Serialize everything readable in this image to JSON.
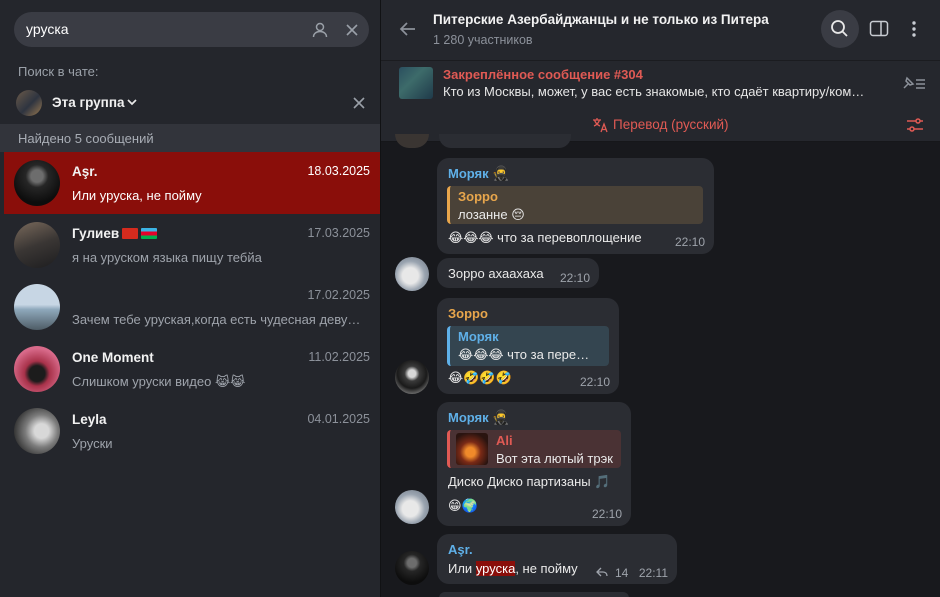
{
  "search": {
    "query": "уруска"
  },
  "left": {
    "search_in_chat_label": "Поиск в чате:",
    "scope_label": "Эта группа",
    "found_label": "Найдено 5 сообщений",
    "results": [
      {
        "name": "Aşr.",
        "date": "18.03.2025",
        "snippet": "Или уруска, не пойму",
        "active": true
      },
      {
        "name": "Гулиев",
        "date": "17.03.2025",
        "snippet": "я на уруском языка пищу тебйа",
        "active": false
      },
      {
        "name": "",
        "date": "17.02.2025",
        "snippet": "Зачем тебе уруская,когда есть чудесная деву…",
        "active": false
      },
      {
        "name": "One Moment",
        "date": "11.02.2025",
        "snippet": "Слишком уруски видео 😹😹",
        "active": false
      },
      {
        "name": "Leyla",
        "date": "04.01.2025",
        "snippet": "Уруски",
        "active": false
      }
    ]
  },
  "chat": {
    "title": "Питерские Азербайджанцы и не только из Питера",
    "members": "1 280 участников",
    "pinned_title": "Закреплённое сообщение #304",
    "pinned_text": "Кто из Москвы, может, у вас есть знакомые, кто сдаёт квартиру/ком…",
    "translate_label": "Перевод (русский)",
    "messages": {
      "m1": {
        "sender": "Моряк",
        "quote_name": "Зорро",
        "quote_text": "лозанне 😔",
        "text": "😂😂😂 что за перевоплощение",
        "time": "22:10"
      },
      "m2": {
        "text": "Зорро ахаахаха",
        "time": "22:10"
      },
      "m3": {
        "sender": "Зорро",
        "quote_name": "Моряк",
        "quote_text": "😂😂😂 что за пере…",
        "text": "😂🤣🤣🤣",
        "time": "22:10"
      },
      "m4": {
        "sender": "Моряк",
        "quote_name": "Ali",
        "quote_text": "Вот эта лютый трэк",
        "text": "Диско Диско партизаны 🎵",
        "text2": "😁🌍",
        "time": "22:10"
      },
      "m5": {
        "sender": "Aşr.",
        "text_before": "Или ",
        "text_hl": "уруска",
        "text_after": ", не пойму",
        "replies": "14",
        "time": "22:11"
      }
    }
  },
  "colors": {
    "accent_red": "#e05a54",
    "active_row": "#8a0e0a",
    "link_blue": "#5fb0e8",
    "sender_orange": "#e8a64c"
  },
  "icons": [
    "person-icon",
    "close-icon",
    "chevron-down-icon",
    "back-arrow-icon",
    "search-icon",
    "side-panel-icon",
    "more-vertical-icon",
    "pin-list-icon",
    "translate-icon",
    "settings-sliders-icon",
    "reply-icon"
  ]
}
